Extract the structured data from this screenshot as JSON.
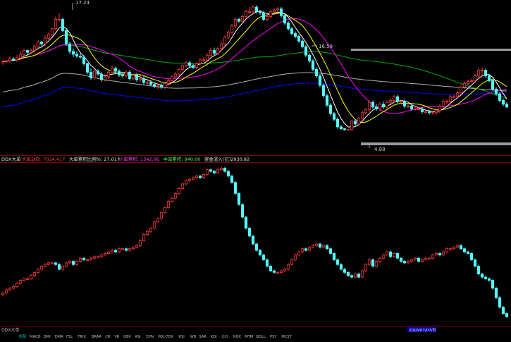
{
  "colors": {
    "up": "#ff3b3b",
    "down": "#54fcfc",
    "ma5": "#ffffff",
    "ma10": "#ffff00",
    "ma20": "#ff00ff",
    "ma60": "#00aa00",
    "ma120": "#b0b0b0",
    "ma250": "#0000ff",
    "separator": "#800000",
    "flat": "#ffffff"
  },
  "price_panel": {
    "annotations": {
      "high": "17.24",
      "mid_high": "16.59",
      "low": "4.88"
    }
  },
  "indicator_bar": {
    "items": [
      {
        "label": "DDX大单",
        "color": "#e0e0e0"
      },
      {
        "label": "大单动向: 7034.41↑",
        "color": "#ff4040"
      },
      {
        "label": "大单累积比例%: 27.01↑",
        "color": "#e0e0e0"
      },
      {
        "label": "小单累积: 1342.06",
        "color": "#ff40ff"
      },
      {
        "label": "中单累积: 940.00",
        "color": "#40ff40"
      },
      {
        "label": "资金流入(亿)",
        "color": "#e0e0e0"
      },
      {
        "label": "2930.92",
        "color": "#e0e0e0"
      }
    ]
  },
  "bottom_bar": {
    "items": [
      "MACD",
      "DMI",
      "DMA",
      "FSL",
      "TRIX",
      "BRAR",
      "CR",
      "VR",
      "OBV",
      "ASI",
      "EMV",
      "VOL-TDX",
      "RSI",
      "WR",
      "SAR",
      "KDJ",
      "CCI",
      "ROC",
      "MTM",
      "BOLL",
      "PSY",
      "MCST"
    ],
    "left_tag": "DDX大单",
    "date_tag": "2016/07/07/五",
    "page_tag": "全部"
  },
  "chart_data": [
    {
      "type": "candlestick",
      "title": "",
      "ylim": [
        2.5,
        18.5
      ],
      "grid": false,
      "annotations": [
        {
          "text": "17.24",
          "x": 17,
          "y": 17.24
        },
        {
          "text": "16.59",
          "x": 81,
          "y": 16.59
        },
        {
          "text": "4.88",
          "x": 100,
          "y": 4.88
        }
      ],
      "x": [
        1,
        2,
        3,
        4,
        5,
        6,
        7,
        8,
        9,
        10,
        11,
        12,
        13,
        14,
        15,
        16,
        17,
        18,
        19,
        20,
        21,
        22,
        23,
        24,
        25,
        26,
        27,
        28,
        29,
        30,
        31,
        32,
        33,
        34,
        35,
        36,
        37,
        38,
        39,
        40,
        41,
        42,
        43,
        44,
        45,
        46,
        47,
        48,
        49,
        50,
        51,
        52,
        53,
        54,
        55,
        56,
        57,
        58,
        59,
        60,
        61,
        62,
        63,
        64,
        65,
        66,
        67,
        68,
        69,
        70,
        71,
        72,
        73,
        74,
        75,
        76,
        77,
        78,
        79,
        80,
        81,
        82,
        83,
        84,
        85,
        86,
        87,
        88,
        89,
        90,
        91,
        92,
        93,
        94,
        95,
        96,
        97,
        98,
        99,
        100,
        101,
        102,
        103,
        104,
        105,
        106,
        107,
        108,
        109,
        110,
        111,
        112,
        113,
        114,
        115,
        116,
        117,
        118,
        119,
        120,
        121,
        122,
        123,
        124,
        125,
        126,
        127,
        128,
        129,
        130,
        131,
        132,
        133,
        134,
        135,
        136,
        137,
        138,
        139,
        140,
        141,
        142,
        143,
        144
      ],
      "open": [
        12.0,
        12.1,
        12.2,
        12.4,
        12.3,
        12.5,
        12.9,
        13.3,
        13.1,
        13.3,
        13.7,
        14.2,
        14.0,
        14.6,
        15.0,
        15.6,
        16.6,
        16.6,
        15.4,
        14.0,
        13.2,
        12.9,
        12.7,
        12.6,
        11.9,
        11.0,
        10.4,
        11.1,
        10.8,
        10.2,
        10.5,
        11.0,
        11.4,
        11.1,
        10.7,
        10.6,
        11.0,
        10.3,
        10.7,
        10.2,
        10.3,
        9.9,
        9.9,
        9.7,
        9.5,
        9.6,
        9.4,
        9.8,
        10.1,
        10.5,
        10.8,
        11.3,
        11.7,
        12.0,
        11.7,
        11.5,
        11.9,
        12.3,
        12.3,
        12.8,
        13.3,
        13.0,
        13.5,
        14.0,
        14.7,
        15.2,
        15.9,
        16.6,
        16.4,
        16.9,
        17.4,
        17.4,
        17.9,
        17.4,
        17.3,
        16.6,
        16.9,
        17.4,
        17.6,
        17.7,
        17.0,
        16.2,
        15.6,
        15.1,
        14.8,
        14.3,
        13.7,
        12.8,
        12.2,
        11.3,
        10.6,
        9.6,
        8.5,
        7.5,
        6.6,
        6.0,
        5.2,
        5.0,
        4.9,
        4.9,
        5.8,
        5.5,
        6.1,
        6.7,
        7.0,
        7.8,
        7.3,
        7.1,
        7.6,
        7.3,
        7.8,
        8.0,
        8.4,
        7.9,
        7.9,
        7.4,
        7.4,
        7.1,
        7.1,
        7.1,
        6.8,
        6.8,
        6.7,
        6.7,
        6.9,
        7.4,
        7.9,
        7.9,
        8.4,
        8.4,
        8.8,
        9.4,
        9.8,
        10.0,
        10.1,
        10.6,
        11.2,
        11.2,
        10.6,
        10.1,
        9.2,
        8.7,
        8.0,
        7.6
      ],
      "high": [
        12.3,
        12.3,
        12.7,
        12.6,
        12.8,
        13.2,
        13.5,
        13.4,
        13.5,
        13.9,
        14.4,
        14.3,
        14.9,
        15.2,
        15.7,
        16.9,
        17.24,
        16.8,
        15.6,
        14.2,
        13.5,
        13.2,
        13.0,
        12.8,
        12.0,
        11.4,
        11.3,
        11.3,
        11.0,
        10.8,
        11.1,
        11.7,
        11.6,
        11.3,
        10.9,
        11.2,
        11.2,
        10.9,
        10.9,
        10.7,
        10.6,
        10.1,
        10.2,
        9.9,
        9.8,
        9.8,
        9.9,
        10.3,
        10.7,
        11.0,
        11.4,
        11.8,
        12.2,
        12.2,
        11.9,
        12.1,
        12.5,
        12.6,
        13.0,
        13.6,
        13.6,
        13.7,
        14.2,
        14.9,
        15.4,
        16.1,
        16.8,
        16.8,
        17.1,
        17.6,
        17.9,
        18.1,
        18.1,
        17.6,
        17.5,
        17.1,
        17.6,
        17.8,
        17.9,
        17.9,
        17.2,
        16.4,
        15.8,
        15.3,
        15.0,
        14.5,
        13.9,
        13.0,
        12.4,
        11.5,
        10.8,
        9.8,
        8.7,
        7.7,
        6.8,
        6.2,
        5.4,
        5.1,
        5.0,
        5.9,
        6.0,
        6.3,
        6.9,
        7.2,
        8.0,
        8.0,
        7.6,
        7.8,
        7.9,
        8.0,
        8.2,
        8.6,
        8.6,
        8.1,
        8.1,
        7.6,
        7.5,
        7.3,
        7.3,
        7.3,
        7.0,
        7.0,
        6.9,
        7.0,
        7.6,
        8.1,
        8.1,
        8.6,
        8.6,
        9.0,
        9.6,
        10.0,
        10.2,
        10.3,
        10.8,
        11.4,
        11.5,
        11.4,
        10.8,
        10.3,
        9.4,
        8.9,
        8.2,
        7.8
      ],
      "low": [
        11.8,
        11.9,
        12.0,
        12.2,
        12.1,
        12.3,
        12.7,
        12.8,
        12.9,
        13.1,
        13.5,
        13.8,
        13.8,
        14.4,
        14.8,
        15.4,
        16.4,
        15.2,
        13.8,
        12.9,
        12.6,
        12.5,
        12.4,
        11.7,
        10.8,
        10.2,
        10.2,
        10.6,
        10.0,
        10.0,
        10.3,
        10.8,
        10.9,
        10.5,
        10.4,
        10.4,
        10.1,
        10.1,
        10.0,
        10.0,
        9.7,
        9.6,
        9.5,
        9.3,
        9.2,
        9.2,
        9.2,
        9.6,
        9.9,
        10.3,
        10.6,
        11.1,
        11.5,
        11.5,
        11.3,
        11.3,
        11.7,
        12.1,
        12.1,
        12.6,
        12.8,
        12.8,
        13.3,
        13.8,
        14.5,
        15.0,
        15.7,
        16.2,
        16.2,
        16.7,
        17.2,
        17.2,
        17.2,
        17.1,
        16.4,
        16.4,
        16.7,
        17.2,
        17.4,
        16.8,
        16.0,
        15.4,
        14.9,
        14.6,
        14.1,
        13.5,
        12.6,
        12.0,
        11.1,
        10.4,
        9.4,
        8.3,
        7.3,
        6.4,
        5.8,
        5.0,
        4.88,
        4.8,
        4.8,
        4.8,
        5.3,
        5.3,
        5.9,
        6.5,
        6.8,
        7.1,
        6.9,
        6.9,
        7.1,
        7.1,
        7.6,
        7.8,
        7.7,
        7.7,
        7.2,
        7.2,
        6.9,
        6.9,
        6.9,
        6.6,
        6.6,
        6.5,
        6.5,
        6.5,
        6.7,
        7.2,
        7.6,
        7.7,
        8.2,
        8.2,
        8.6,
        9.2,
        9.6,
        9.8,
        9.9,
        10.4,
        10.4,
        10.4,
        9.9,
        9.0,
        8.5,
        7.8,
        7.4,
        7.2
      ],
      "close": [
        12.1,
        12.2,
        12.4,
        12.3,
        12.5,
        12.9,
        13.3,
        13.1,
        13.3,
        13.7,
        14.2,
        14.0,
        14.6,
        15.0,
        15.6,
        16.6,
        16.6,
        15.4,
        14.0,
        13.2,
        12.9,
        12.7,
        12.6,
        11.9,
        11.0,
        10.4,
        11.1,
        10.8,
        10.2,
        10.5,
        11.0,
        11.4,
        11.1,
        10.7,
        10.6,
        11.0,
        10.3,
        10.7,
        10.2,
        10.3,
        9.9,
        9.9,
        9.7,
        9.5,
        9.6,
        9.4,
        9.8,
        10.1,
        10.5,
        10.8,
        11.3,
        11.7,
        12.0,
        11.7,
        11.5,
        11.9,
        12.3,
        12.3,
        12.8,
        13.3,
        13.0,
        13.5,
        14.0,
        14.7,
        15.2,
        15.9,
        16.6,
        16.4,
        16.9,
        17.4,
        17.4,
        17.9,
        17.4,
        17.3,
        16.6,
        16.9,
        17.4,
        17.6,
        17.7,
        17.0,
        16.2,
        15.6,
        15.1,
        14.8,
        14.3,
        13.7,
        12.8,
        12.2,
        11.3,
        10.6,
        9.6,
        8.5,
        7.5,
        6.6,
        6.0,
        5.2,
        5.0,
        4.9,
        4.9,
        5.8,
        5.5,
        6.1,
        6.7,
        7.0,
        7.8,
        7.3,
        7.1,
        7.6,
        7.3,
        7.8,
        8.0,
        8.4,
        7.9,
        7.9,
        7.4,
        7.4,
        7.1,
        7.1,
        7.1,
        6.8,
        6.8,
        6.7,
        6.7,
        6.9,
        7.4,
        7.9,
        7.9,
        8.4,
        8.4,
        8.8,
        9.4,
        9.8,
        10.0,
        10.1,
        10.6,
        11.2,
        11.2,
        10.6,
        10.1,
        9.2,
        8.7,
        8.0,
        7.6,
        7.3
      ]
    },
    {
      "type": "candlestick",
      "title": "DDX大单",
      "ylim": [
        0,
        100
      ],
      "grid": false,
      "x": [
        1,
        2,
        3,
        4,
        5,
        6,
        7,
        8,
        9,
        10,
        11,
        12,
        13,
        14,
        15,
        16,
        17,
        18,
        19,
        20,
        21,
        22,
        23,
        24,
        25,
        26,
        27,
        28,
        29,
        30,
        31,
        32,
        33,
        34,
        35,
        36,
        37,
        38,
        39,
        40,
        41,
        42,
        43,
        44,
        45,
        46,
        47,
        48,
        49,
        50,
        51,
        52,
        53,
        54,
        55,
        56,
        57,
        58,
        59,
        60,
        61,
        62,
        63,
        64,
        65,
        66,
        67,
        68,
        69,
        70,
        71,
        72,
        73,
        74,
        75,
        76,
        77,
        78,
        79,
        80,
        81,
        82,
        83,
        84,
        85,
        86,
        87,
        88,
        89,
        90,
        91,
        92,
        93,
        94,
        95,
        96,
        97,
        98,
        99,
        100,
        101,
        102,
        103,
        104,
        105,
        106,
        107,
        108,
        109,
        110,
        111,
        112,
        113,
        114,
        115,
        116,
        117,
        118,
        119,
        120,
        121,
        122,
        123,
        124,
        125,
        126,
        127,
        128,
        129,
        130,
        131,
        132,
        133,
        134,
        135,
        136,
        137,
        138,
        139,
        140,
        141,
        142,
        143,
        144
      ],
      "open": [
        18,
        19,
        21,
        22,
        23,
        25,
        27,
        28,
        28,
        30,
        32,
        34,
        36,
        37,
        38,
        38,
        37,
        34,
        36,
        38,
        39,
        37,
        39,
        41,
        40,
        40,
        41,
        42,
        42,
        43,
        44,
        45,
        46,
        45,
        47,
        47,
        46,
        47,
        48,
        49,
        52,
        56,
        58,
        60,
        64,
        66,
        70,
        73,
        77,
        79,
        82,
        85,
        88,
        90,
        91,
        92,
        93,
        92,
        94,
        97,
        96,
        95,
        97,
        98,
        96,
        93,
        89,
        82,
        75,
        67,
        60,
        55,
        50,
        46,
        43,
        40,
        36,
        33,
        32,
        32,
        33,
        34,
        37,
        40,
        43,
        45,
        47,
        46,
        48,
        49,
        50,
        48,
        49,
        47,
        44,
        40,
        37,
        34,
        32,
        30,
        29,
        31,
        29,
        33,
        37,
        40,
        36,
        39,
        41,
        43,
        45,
        42,
        44,
        41,
        39,
        38,
        39,
        40,
        41,
        39,
        40,
        41,
        41,
        43,
        44,
        43,
        45,
        47,
        47,
        48,
        49,
        47,
        45,
        44,
        40,
        36,
        31,
        29,
        28,
        27,
        22,
        16,
        10,
        6
      ],
      "close": [
        19,
        21,
        22,
        23,
        25,
        27,
        28,
        28,
        30,
        32,
        34,
        36,
        37,
        38,
        38,
        37,
        34,
        36,
        38,
        39,
        37,
        39,
        41,
        40,
        40,
        41,
        42,
        42,
        43,
        44,
        45,
        46,
        45,
        47,
        47,
        46,
        47,
        48,
        49,
        52,
        56,
        58,
        60,
        64,
        66,
        70,
        73,
        77,
        79,
        82,
        85,
        88,
        90,
        91,
        92,
        93,
        92,
        94,
        97,
        96,
        95,
        97,
        98,
        96,
        93,
        89,
        82,
        75,
        67,
        60,
        55,
        50,
        46,
        43,
        40,
        36,
        33,
        32,
        32,
        33,
        34,
        37,
        40,
        43,
        45,
        47,
        46,
        48,
        49,
        50,
        48,
        49,
        47,
        44,
        40,
        37,
        34,
        32,
        30,
        29,
        31,
        29,
        33,
        37,
        40,
        36,
        39,
        41,
        43,
        45,
        42,
        44,
        41,
        39,
        38,
        39,
        40,
        41,
        39,
        40,
        41,
        41,
        43,
        44,
        43,
        45,
        47,
        47,
        48,
        49,
        47,
        45,
        44,
        40,
        36,
        31,
        29,
        28,
        27,
        22,
        16,
        10,
        6,
        4
      ]
    }
  ]
}
